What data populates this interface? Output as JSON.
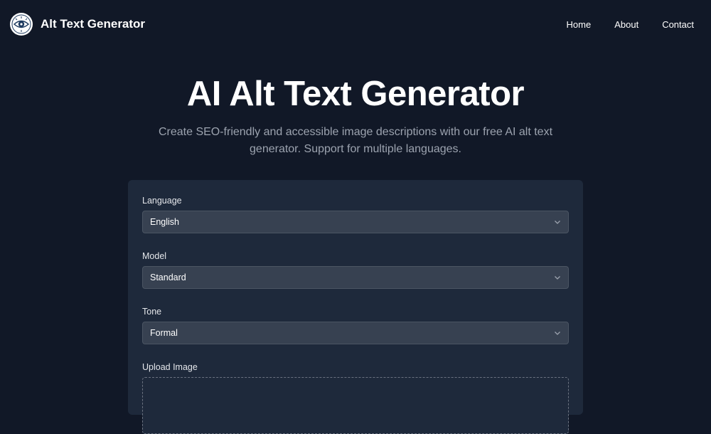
{
  "nav": {
    "brand": "Alt Text Generator",
    "links": [
      "Home",
      "About",
      "Contact"
    ]
  },
  "hero": {
    "title": "AI Alt Text Generator",
    "subtitle_line1": "Create SEO-friendly and accessible image descriptions with our free AI alt text",
    "subtitle_line2": "generator. Support for multiple languages."
  },
  "form": {
    "language": {
      "label": "Language",
      "value": "English"
    },
    "model": {
      "label": "Model",
      "value": "Standard"
    },
    "tone": {
      "label": "Tone",
      "value": "Formal"
    },
    "upload": {
      "label": "Upload Image"
    }
  },
  "colors": {
    "background": "#111827",
    "card": "#1e293b",
    "select": "#374151",
    "muted_text": "#9ca3af"
  },
  "icons": [
    "eye-logo-icon",
    "chevron-down-icon"
  ]
}
